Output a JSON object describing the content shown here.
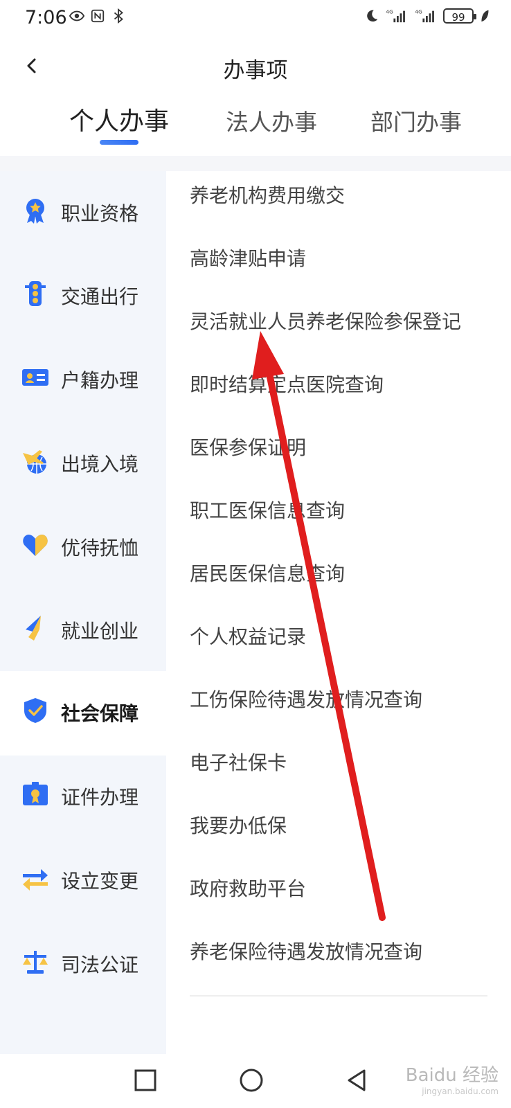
{
  "status_bar": {
    "time": "7:06",
    "battery": "99",
    "network_1": "4G",
    "network_2": "4G"
  },
  "header": {
    "title": "办事项"
  },
  "tabs": [
    {
      "label": "个人办事",
      "active": true
    },
    {
      "label": "法人办事",
      "active": false
    },
    {
      "label": "部门办事",
      "active": false
    }
  ],
  "sidebar": {
    "items": [
      {
        "label": "职业资格",
        "icon": "medal-icon"
      },
      {
        "label": "交通出行",
        "icon": "traffic-light-icon"
      },
      {
        "label": "户籍办理",
        "icon": "id-card-icon"
      },
      {
        "label": "出境入境",
        "icon": "plane-globe-icon"
      },
      {
        "label": "优待抚恤",
        "icon": "heart-icon"
      },
      {
        "label": "就业创业",
        "icon": "rocket-icon"
      },
      {
        "label": "社会保障",
        "icon": "shield-check-icon",
        "active": true
      },
      {
        "label": "证件办理",
        "icon": "certificate-icon"
      },
      {
        "label": "设立变更",
        "icon": "exchange-icon"
      },
      {
        "label": "司法公证",
        "icon": "scale-icon"
      }
    ]
  },
  "services": [
    "养老机构费用缴交",
    "高龄津贴申请",
    "灵活就业人员养老保险参保登记",
    "即时结算定点医院查询",
    "医保参保证明",
    "职工医保信息查询",
    "居民医保信息查询",
    "个人权益记录",
    "工伤保险待遇发放情况查询",
    "电子社保卡",
    "我要办低保",
    "政府救助平台",
    "养老保险待遇发放情况查询"
  ],
  "watermark": {
    "brand": "Baidu 经验",
    "url": "jingyan.baidu.com"
  },
  "colors": {
    "accent": "#2f6ef3",
    "icon_blue": "#2f6ef3",
    "icon_yellow": "#f6c344",
    "sidebar_bg": "#f3f6fb",
    "annotation_arrow": "#e01e1e"
  }
}
